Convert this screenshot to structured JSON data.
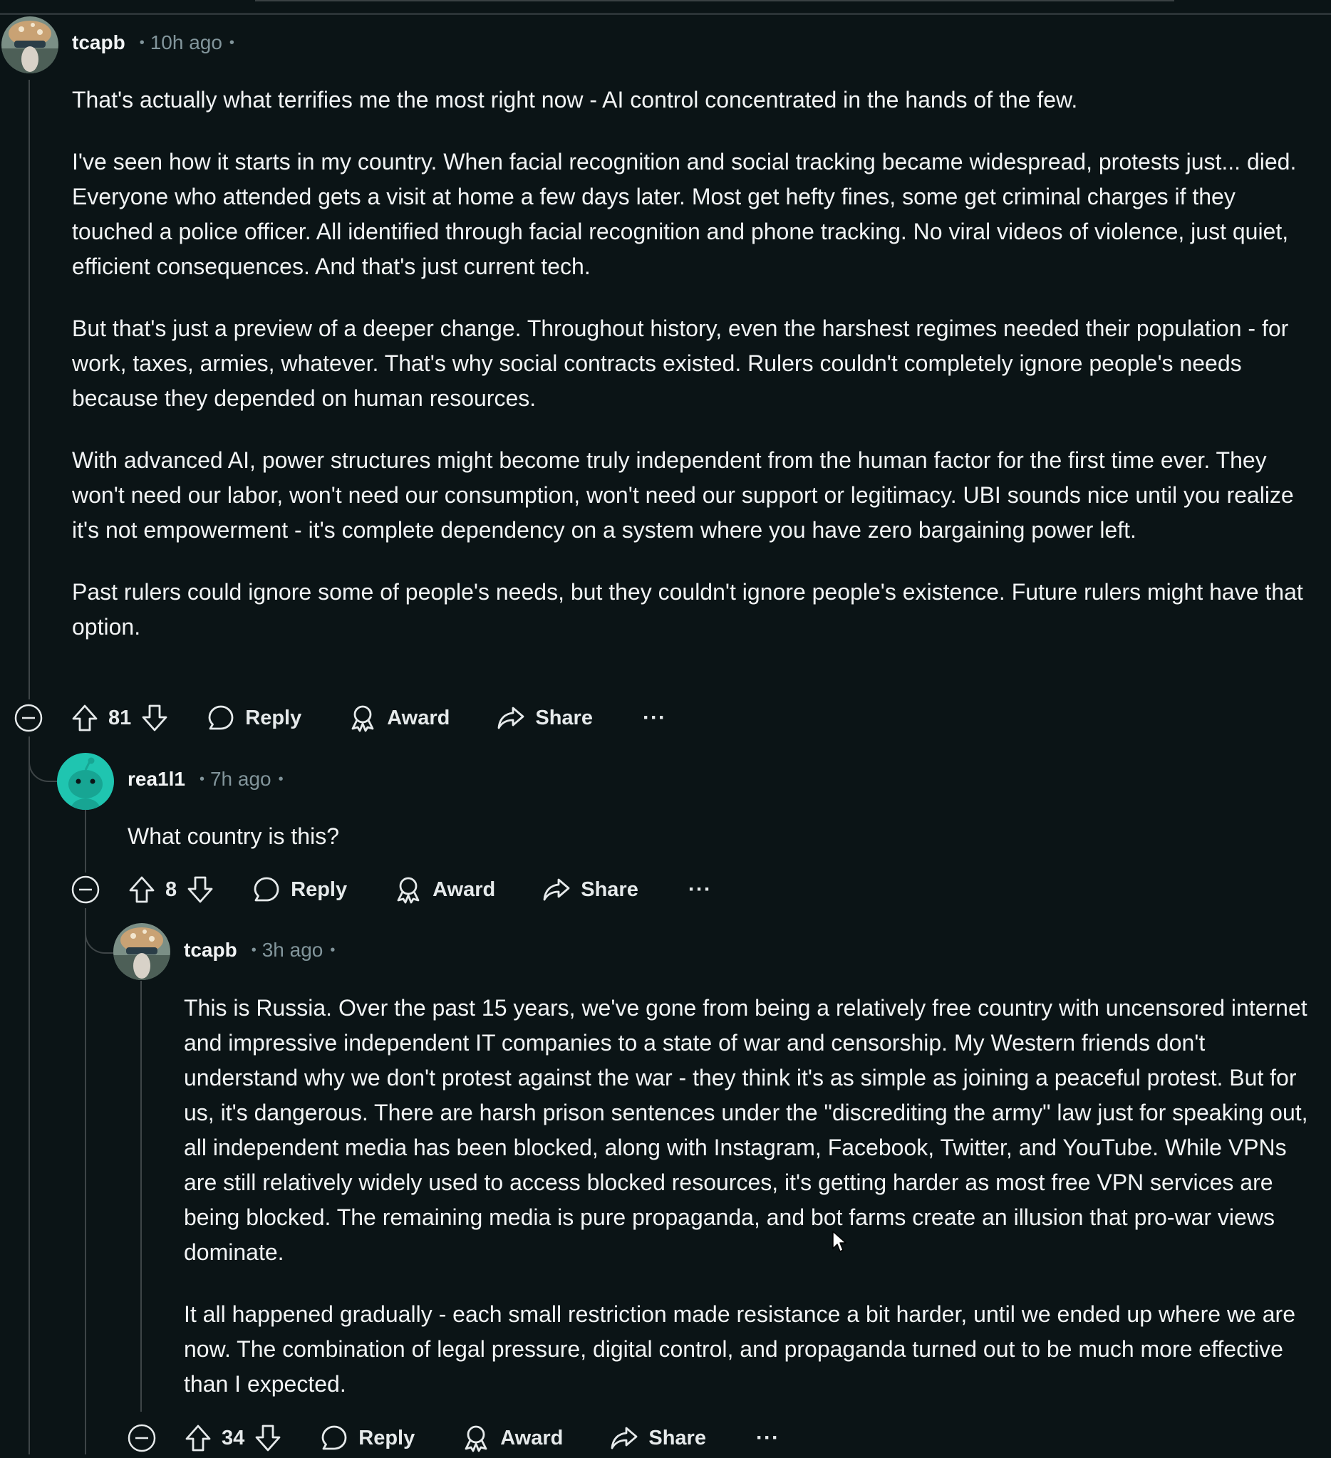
{
  "comments": [
    {
      "username": "tcapb",
      "time": "10h ago",
      "paragraphs": [
        "That's actually what terrifies me the most right now - AI control concentrated in the hands of the few.",
        "I've seen how it starts in my country. When facial recognition and social tracking became widespread, protests just... died. Everyone who attended gets a visit at home a few days later. Most get hefty fines, some get criminal charges if they touched a police officer. All identified through facial recognition and phone tracking. No viral videos of violence, just quiet, efficient consequences. And that's just current tech.",
        "But that's just a preview of a deeper change. Throughout history, even the harshest regimes needed their population - for work, taxes, armies, whatever. That's why social contracts existed. Rulers couldn't completely ignore people's needs because they depended on human resources.",
        "With advanced AI, power structures might become truly independent from the human factor for the first time ever. They won't need our labor, won't need our consumption, won't need our support or legitimacy. UBI sounds nice until you realize it's not empowerment - it's complete dependency on a system where you have zero bargaining power left.",
        "Past rulers could ignore some of people's needs, but they couldn't ignore people's existence. Future rulers might have that option."
      ],
      "score": "81"
    },
    {
      "username": "rea1l1",
      "time": "7h ago",
      "paragraphs": [
        "What country is this?"
      ],
      "score": "8"
    },
    {
      "username": "tcapb",
      "time": "3h ago",
      "paragraphs": [
        "This is Russia. Over the past 15 years, we've gone from being a relatively free country with uncensored internet and impressive independent IT companies to a state of war and censorship. My Western friends don't understand why we don't protest against the war - they think it's as simple as joining a peaceful protest. But for us, it's dangerous. There are harsh prison sentences under the \"discrediting the army\" law just for speaking out, all independent media has been blocked, along with Instagram, Facebook, Twitter, and YouTube. While VPNs are still relatively widely used to access blocked resources, it's getting harder as most free VPN services are being blocked. The remaining media is pure propaganda, and bot farms create an illusion that pro-war views dominate.",
        "It all happened gradually - each small restriction made resistance a bit harder, until we ended up where we are now. The combination of legal pressure, digital control, and propaganda turned out to be much more effective than I expected."
      ],
      "score": "34"
    }
  ],
  "actions": {
    "reply": "Reply",
    "award": "Award",
    "share": "Share",
    "more": "···"
  },
  "separator": "•",
  "icons": [
    "collapse-icon",
    "upvote-icon",
    "downvote-icon",
    "reply-icon",
    "award-icon",
    "share-icon",
    "more-icon",
    "cursor-icon"
  ],
  "colors": {
    "background": "#0b1416",
    "text": "#f2f4f5",
    "meta": "#82959b",
    "thread_line": "#3e4547",
    "snoo_avatar": "#1fc5b0"
  }
}
